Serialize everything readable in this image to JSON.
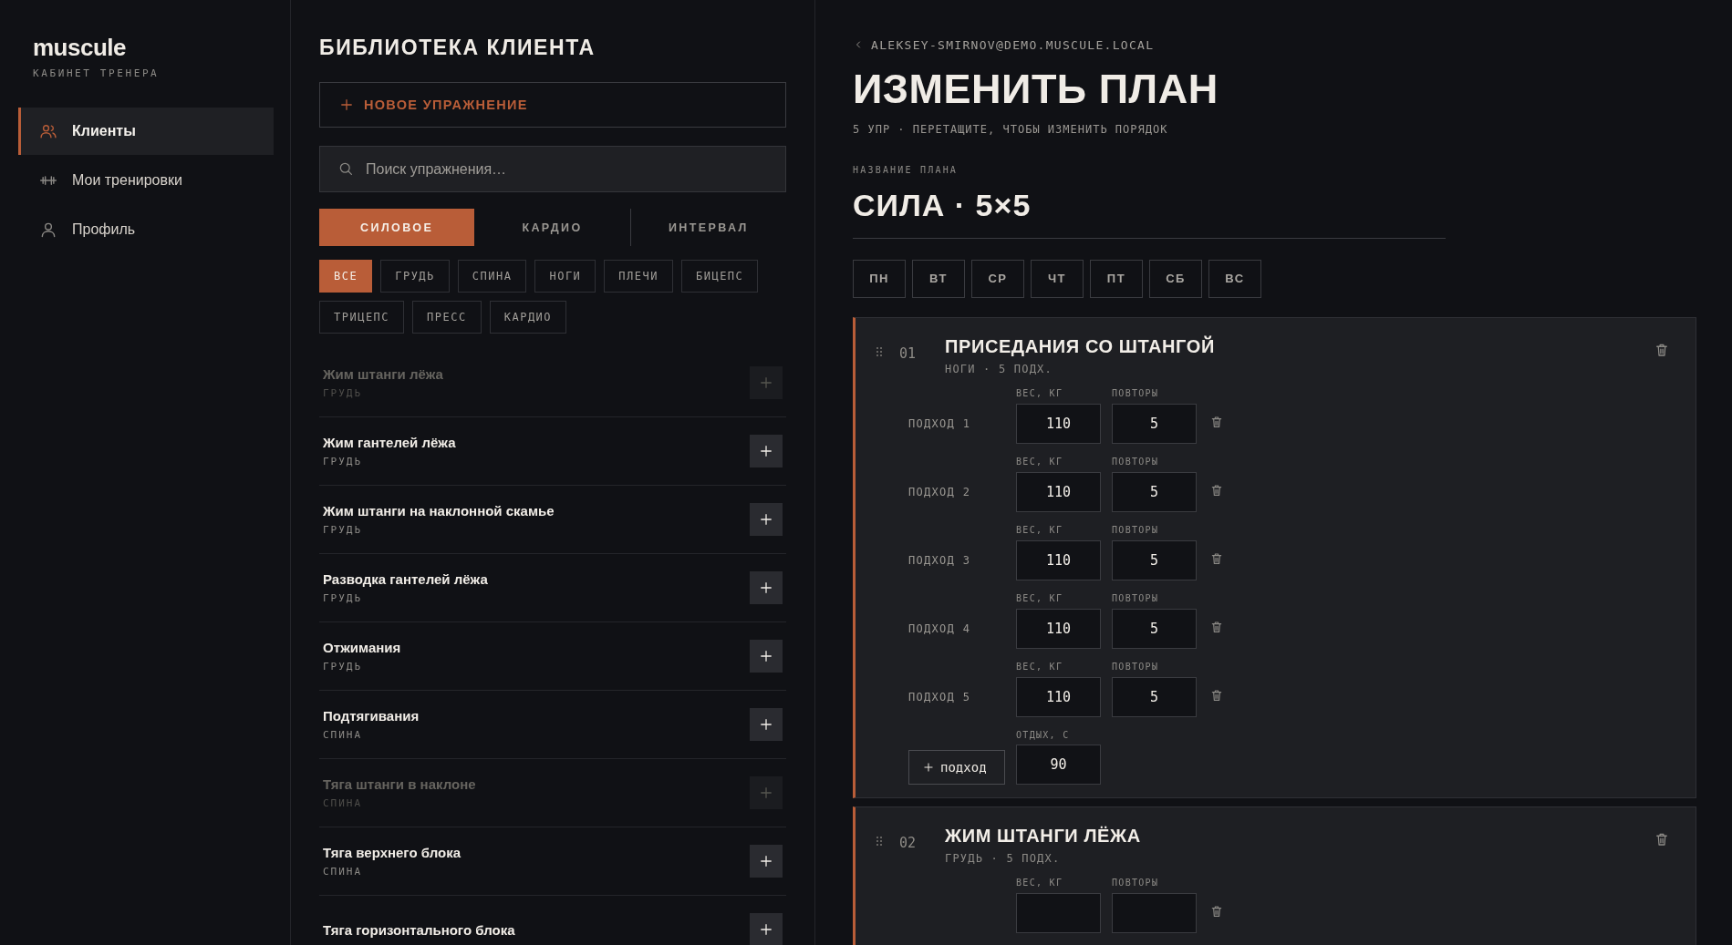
{
  "sidebar": {
    "logo": "muscule",
    "subtitle": "КАБИНЕТ ТРЕНЕРА",
    "items": [
      {
        "label": "Клиенты",
        "selected": true
      },
      {
        "label": "Мои тренировки",
        "selected": false
      },
      {
        "label": "Профиль",
        "selected": false
      }
    ]
  },
  "library": {
    "title": "БИБЛИОТЕКА КЛИЕНТА",
    "new_button": "НОВОЕ УПРАЖНЕНИЕ",
    "search": {
      "placeholder": "Поиск упражнения…"
    },
    "types": [
      {
        "label": "СИЛОВОЕ",
        "selected": true
      },
      {
        "label": "КАРДИО",
        "selected": false
      },
      {
        "label": "ИНТЕРВАЛ",
        "selected": false
      }
    ],
    "muscle_filters": [
      {
        "label": "ВСЕ",
        "selected": true
      },
      {
        "label": "ГРУДЬ",
        "selected": false
      },
      {
        "label": "СПИНА",
        "selected": false
      },
      {
        "label": "НОГИ",
        "selected": false
      },
      {
        "label": "ПЛЕЧИ",
        "selected": false
      },
      {
        "label": "БИЦЕПС",
        "selected": false
      },
      {
        "label": "ТРИЦЕПС",
        "selected": false
      },
      {
        "label": "ПРЕСС",
        "selected": false
      },
      {
        "label": "КАРДИО",
        "selected": false
      }
    ],
    "exercises": [
      {
        "name": "Жим штанги лёжа",
        "group": "ГРУДЬ",
        "disabled": true
      },
      {
        "name": "Жим гантелей лёжа",
        "group": "ГРУДЬ",
        "disabled": false
      },
      {
        "name": "Жим штанги на наклонной скамье",
        "group": "ГРУДЬ",
        "disabled": false
      },
      {
        "name": "Разводка гантелей лёжа",
        "group": "ГРУДЬ",
        "disabled": false
      },
      {
        "name": "Отжимания",
        "group": "ГРУДЬ",
        "disabled": false
      },
      {
        "name": "Подтягивания",
        "group": "СПИНА",
        "disabled": false
      },
      {
        "name": "Тяга штанги в наклоне",
        "group": "СПИНА",
        "disabled": true
      },
      {
        "name": "Тяга верхнего блока",
        "group": "СПИНА",
        "disabled": false
      },
      {
        "name": "Тяга горизонтального блока",
        "disabled": false
      }
    ]
  },
  "editor": {
    "back_link": "ALEKSEY-SMIRNOV@DEMO.MUSCULE.LOCAL",
    "title": "ИЗМЕНИТЬ ПЛАН",
    "subtitle": "5 УПР · ПЕРЕТАЩИТЕ, ЧТОБЫ ИЗМЕНИТЬ ПОРЯДОК",
    "plan_name_label": "НАЗВАНИЕ ПЛАНА",
    "plan_name": "СИЛА · 5×5",
    "days": [
      {
        "label": "ПН",
        "selected": false
      },
      {
        "label": "ВТ",
        "selected": false
      },
      {
        "label": "СР",
        "selected": false
      },
      {
        "label": "ЧТ",
        "selected": false
      },
      {
        "label": "ПТ",
        "selected": false
      },
      {
        "label": "СБ",
        "selected": false
      },
      {
        "label": "ВС",
        "selected": false
      }
    ],
    "exercises": [
      {
        "number": "01",
        "name": "ПРИСЕДАНИЯ СО ШТАНГОЙ",
        "meta": "НОГИ · 5 ПОДХ.",
        "sets": [
          {
            "label": "ПОДХОД 1",
            "weight_label": "ВЕС, КГ",
            "weight": "110",
            "reps_label": "ПОВТОРЫ",
            "reps": "5"
          },
          {
            "label": "ПОДХОД 2",
            "weight_label": "ВЕС, КГ",
            "weight": "110",
            "reps_label": "ПОВТОРЫ",
            "reps": "5"
          },
          {
            "label": "ПОДХОД 3",
            "weight_label": "ВЕС, КГ",
            "weight": "110",
            "reps_label": "ПОВТОРЫ",
            "reps": "5"
          },
          {
            "label": "ПОДХОД 4",
            "weight_label": "ВЕС, КГ",
            "weight": "110",
            "reps_label": "ПОВТОРЫ",
            "reps": "5"
          },
          {
            "label": "ПОДХОД 5",
            "weight_label": "ВЕС, КГ",
            "weight": "110",
            "reps_label": "ПОВТОРЫ",
            "reps": "5"
          }
        ],
        "add_set": "подход",
        "rest_label": "ОТДЫХ, С",
        "rest": "90"
      },
      {
        "number": "02",
        "name": "ЖИМ ШТАНГИ ЛЁЖА",
        "meta": "ГРУДЬ · 5 ПОДХ.",
        "sets": [
          {
            "weight_label": "ВЕС, КГ",
            "reps_label": "ПОВТОРЫ"
          }
        ]
      }
    ]
  }
}
